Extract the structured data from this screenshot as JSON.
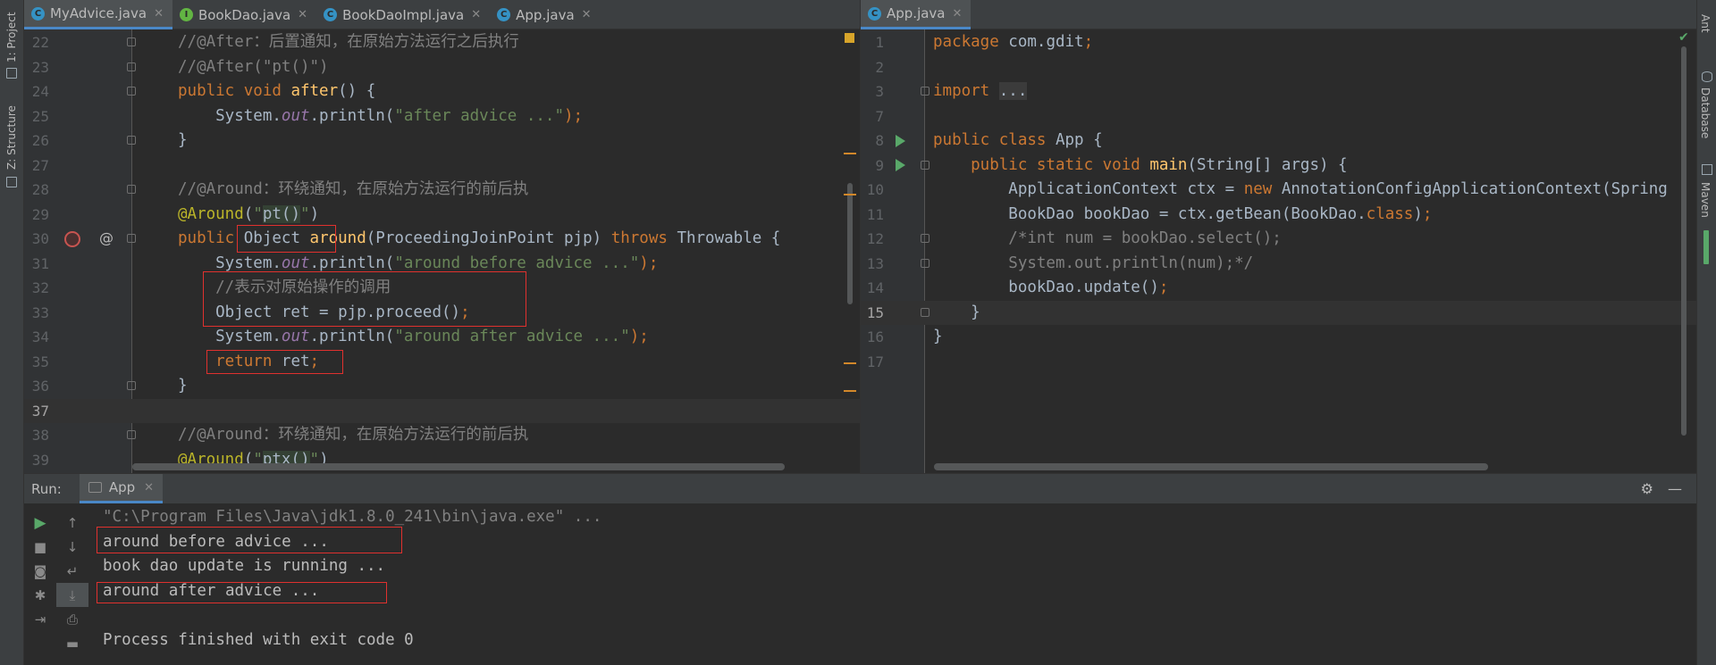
{
  "left_sidebar": {
    "project_label": "1: Project",
    "structure_label": "Z: Structure"
  },
  "right_sidebar": {
    "ant_label": "Ant",
    "database_label": "Database",
    "maven_label": "Maven"
  },
  "left_editor": {
    "tabs": [
      {
        "label": "MyAdvice.java",
        "icon": "class-icon",
        "active": true
      },
      {
        "label": "BookDao.java",
        "icon": "interface-icon",
        "active": false
      },
      {
        "label": "BookDaoImpl.java",
        "icon": "class-icon",
        "active": false
      },
      {
        "label": "App.java",
        "icon": "app-class-icon",
        "active": false
      }
    ],
    "gutter_at": "@",
    "lines": {
      "l22": {
        "n": "22",
        "t1": "//@After：后置通知，在原始方法运行之后执行"
      },
      "l23": {
        "n": "23",
        "t1": "//@After(\"pt()\")"
      },
      "l24": {
        "n": "24",
        "t1": "public void ",
        "t2": "after",
        "t3": "() {"
      },
      "l25": {
        "n": "25",
        "t1": "    System.",
        "t2": "out",
        "t3": ".println(",
        "t4": "\"after advice ...\"",
        "t5": ");"
      },
      "l26": {
        "n": "26",
        "t1": "}"
      },
      "l27": {
        "n": "27"
      },
      "l28": {
        "n": "28",
        "t1": "//@Around：环绕通知，在原始方法运行的前后执"
      },
      "l29": {
        "n": "29",
        "t1": "@Around",
        "t2": "(",
        "t3": "\"",
        "t4": "pt()",
        "t5": "\"",
        "t6": ")"
      },
      "l30": {
        "n": "30",
        "t1": "public ",
        "t2": "Object ",
        "t3": "around",
        "t4": "(ProceedingJoinPoint pjp) ",
        "t5": "throws ",
        "t6": "Throwable {"
      },
      "l31": {
        "n": "31",
        "t1": "    System.",
        "t2": "out",
        "t3": ".println(",
        "t4": "\"around before advice ...\"",
        "t5": ");"
      },
      "l32": {
        "n": "32",
        "t1": "    //表示对原始操作的调用"
      },
      "l33": {
        "n": "33",
        "t1": "    Object ret = pjp.proceed()",
        "t2": ";"
      },
      "l34": {
        "n": "34",
        "t1": "    System.",
        "t2": "out",
        "t3": ".println(",
        "t4": "\"around after advice ...\"",
        "t5": ");"
      },
      "l35": {
        "n": "35",
        "t1": "    return ",
        "t2": "ret",
        "t3": ";"
      },
      "l36": {
        "n": "36",
        "t1": "}"
      },
      "l37": {
        "n": "37"
      },
      "l38": {
        "n": "38",
        "t1": "//@Around：环绕通知，在原始方法运行的前后执"
      },
      "l39": {
        "n": "39",
        "t1": "@Around",
        "t2": "(",
        "t3": "\"",
        "t4": "ptx()",
        "t5": "\"",
        "t6": ")"
      }
    }
  },
  "right_editor": {
    "tabs": [
      {
        "label": "App.java",
        "icon": "app-class-icon",
        "active": true
      }
    ],
    "lines": {
      "r1": {
        "n": "1",
        "t1": "package ",
        "t2": "com.gdit",
        "t3": ";"
      },
      "r2": {
        "n": "2"
      },
      "r3": {
        "n": "3",
        "t1": "import ",
        "t2": "..."
      },
      "r7": {
        "n": "7"
      },
      "r8": {
        "n": "8",
        "t1": "public class ",
        "t2": "App {"
      },
      "r9": {
        "n": "9",
        "t1": "    public static void ",
        "t2": "main",
        "t3": "(String[] args) {"
      },
      "r10": {
        "n": "10",
        "t1": "        ApplicationContext ctx = ",
        "t2": "new ",
        "t3": "AnnotationConfigApplicationContext(Spring"
      },
      "r11": {
        "n": "11",
        "t1": "        BookDao bookDao = ctx.getBean(BookDao.",
        "t2": "class",
        "t3": ")",
        "t4": ";"
      },
      "r12": {
        "n": "12",
        "t1": "        /*int num = bookDao.select();"
      },
      "r13": {
        "n": "13",
        "t1": "        System.out.println(num);*/"
      },
      "r14": {
        "n": "14",
        "t1": "        bookDao.update()",
        "t2": ";"
      },
      "r15": {
        "n": "15",
        "t1": "    }"
      },
      "r16": {
        "n": "16",
        "t1": "}"
      },
      "r17": {
        "n": "17"
      }
    }
  },
  "run_panel": {
    "label": "Run:",
    "tab_label": "App",
    "console": [
      "\"C:\\Program Files\\Java\\jdk1.8.0_241\\bin\\java.exe\" ...",
      "around before advice ...",
      "book dao update is running ...",
      "around after advice ...",
      "",
      "Process finished with exit code 0"
    ]
  },
  "colors": {
    "keyword": "#cc7832",
    "string": "#6a8759",
    "comment": "#808080",
    "annotation": "#bbb529",
    "method": "#ffc66d",
    "static_field": "#9876aa",
    "highlight_box": "#e0312e",
    "run_green": "#59a869",
    "active_tab_underline": "#4a88c7"
  }
}
